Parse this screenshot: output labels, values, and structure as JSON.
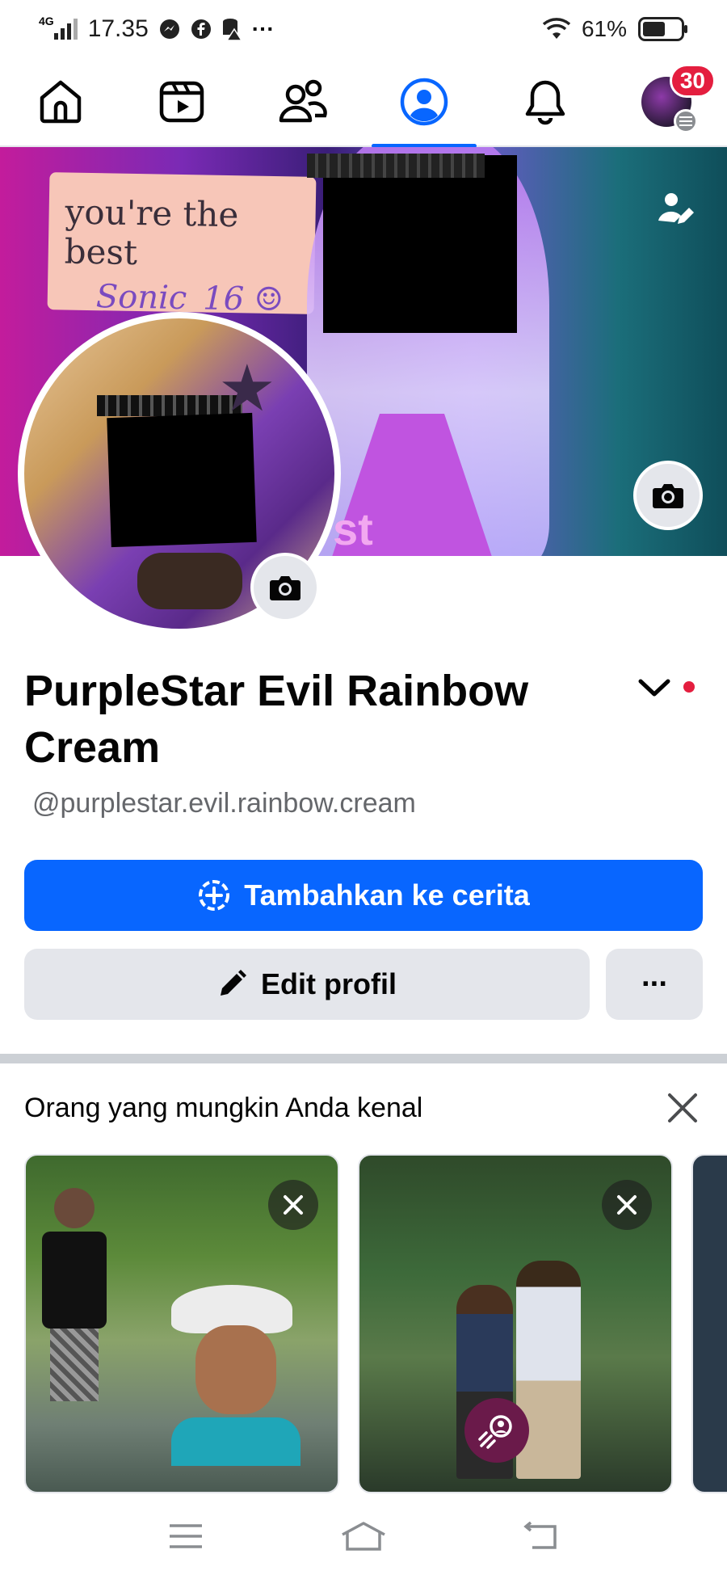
{
  "status_bar": {
    "network": "4G",
    "time": "17.35",
    "battery_percent": "61%",
    "overflow": "···",
    "battery_level": 0.61
  },
  "top_nav": {
    "notification_count": "30",
    "active_tab": "profile"
  },
  "cover": {
    "sign_line1": "you're the best",
    "sign_line2": "Sonic_16 ☺",
    "overlay_text": "st"
  },
  "profile": {
    "name": "PurpleStar Evil Rainbow Cream",
    "username": "@purplestar.evil.rainbow.cream"
  },
  "actions": {
    "add_story_label": "Tambahkan ke cerita",
    "edit_profile_label": "Edit profil",
    "more_label": "···"
  },
  "pymk": {
    "title": "Orang yang mungkin Anda kenal"
  },
  "colors": {
    "primary": "#0866ff",
    "notification_red": "#e41e3f",
    "secondary_button": "#e4e6eb"
  },
  "icons": {
    "home": "home-icon",
    "video": "video-icon",
    "friends": "friends-icon",
    "profile": "profile-icon",
    "notifications": "bell-icon",
    "menu": "menu-icon",
    "camera": "camera-icon",
    "close": "close-icon"
  }
}
